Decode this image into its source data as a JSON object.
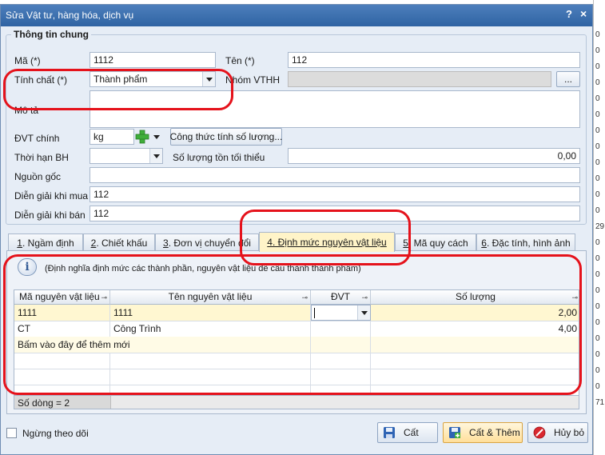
{
  "dialog": {
    "title": "Sửa Vật tư, hàng hóa, dịch vụ",
    "help": "?",
    "close": "×"
  },
  "general": {
    "group_title": "Thông tin chung",
    "ma_label": "Mã (*)",
    "ma_value": "1112",
    "ten_label": "Tên (*)",
    "ten_value": "112",
    "tinhchat_label": "Tính chất (*)",
    "tinhchat_value": "Thành phẩm",
    "nhom_label": "Nhóm VTHH",
    "nhom_value": "",
    "nhom_browse": "...",
    "mota_label": "Mô tả",
    "mota_value": "",
    "dvt_label": "ĐVT chính",
    "dvt_value": "kg",
    "congthuc_button": "Công thức tính số lượng...",
    "thoihan_label": "Thời hạn BH",
    "thoihan_value": "",
    "soluongton_label": "Số lượng tồn tối thiểu",
    "soluongton_value": "0,00",
    "nguongoc_label": "Nguồn gốc",
    "nguongoc_value": "",
    "dgmua_label": "Diễn giải khi mua",
    "dgmua_value": "112",
    "dgban_label": "Diễn giải khi bán",
    "dgban_value": "112"
  },
  "tabs": [
    {
      "num": "1",
      "label": ". Ngầm định"
    },
    {
      "num": "2",
      "label": ". Chiết khấu"
    },
    {
      "num": "3",
      "label": ". Đơn vị chuyển đổi"
    },
    {
      "num": "4",
      "label": ". Định mức nguyên vật liệu"
    },
    {
      "num": "5",
      "label": ". Mã quy cách"
    },
    {
      "num": "6",
      "label": ". Đặc tính, hình ảnh"
    }
  ],
  "bom": {
    "info": "(Định nghĩa định mức các thành phần, nguyên vật liệu để cấu thành thành phẩm)",
    "columns": [
      "Mã nguyên vật liệu",
      "Tên nguyên vật liệu",
      "ĐVT",
      "Số lượng"
    ],
    "rows": [
      {
        "ma": "1111",
        "ten": "1111",
        "dvt": "",
        "sl": "2,00"
      },
      {
        "ma": "CT",
        "ten": "Công Trình",
        "dvt": "",
        "sl": "4,00"
      }
    ],
    "add_new": "Bấm vào đây để thêm mới",
    "row_count": "Số dòng = 2"
  },
  "footer": {
    "ngung_label": "Ngừng theo dõi",
    "cat_button": "Cất",
    "cat_them_button": "Cất & Thêm",
    "huy_button": "Hủy bỏ"
  },
  "background": {
    "right_numbers": [
      "0",
      "0",
      "0",
      "0",
      "0",
      "0",
      "0",
      "0",
      "0",
      "0",
      "0",
      "0",
      "29",
      "0",
      "0",
      "0",
      "0",
      "0",
      "0",
      "0",
      "0",
      "0",
      "0",
      "71"
    ]
  },
  "colors": {
    "title_bar": "#3a6fae",
    "annotation": "#e5121b",
    "active_tab": "#fff4c8",
    "highlight_row": "#fff7d1"
  }
}
